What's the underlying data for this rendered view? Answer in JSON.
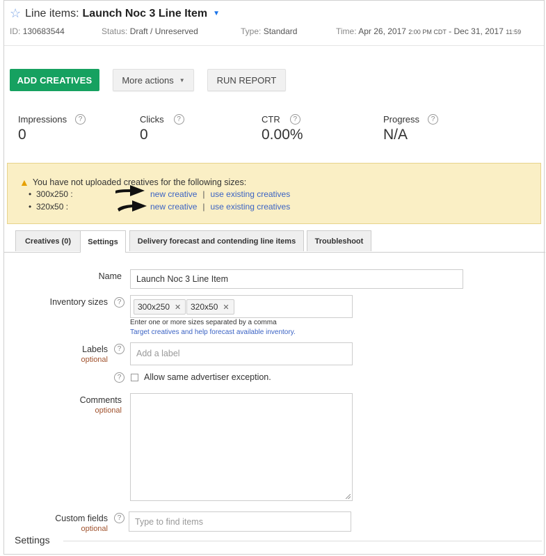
{
  "header": {
    "title_prefix": "Line items:",
    "title_name": "Launch Noc 3 Line Item",
    "id_label": "ID:",
    "id_value": "130683544",
    "status_label": "Status:",
    "status_value": "Draft / Unreserved",
    "type_label": "Type:",
    "type_value": "Standard",
    "time_label": "Time:",
    "time_start_date": "Apr 26, 2017",
    "time_start_clock": "2:00 PM CDT",
    "time_separator": "-",
    "time_end_date": "Dec 31, 2017",
    "time_end_clock": "11:59"
  },
  "toolbar": {
    "add_creatives": "ADD CREATIVES",
    "more_actions": "More actions",
    "run_report": "RUN REPORT"
  },
  "stats": [
    {
      "label": "Impressions",
      "value": "0"
    },
    {
      "label": "Clicks",
      "value": "0"
    },
    {
      "label": "CTR",
      "value": "0.00%"
    },
    {
      "label": "Progress",
      "value": "N/A"
    }
  ],
  "warning": {
    "message": "You have not uploaded creatives for the following sizes:",
    "rows": [
      {
        "size": "300x250 :",
        "new_link": "new creative",
        "sep": "|",
        "existing_link": "use existing creatives"
      },
      {
        "size": "320x50 :",
        "new_link": "new creative",
        "sep": "|",
        "existing_link": "use existing creatives"
      }
    ]
  },
  "tabs": [
    {
      "label": "Creatives (0)"
    },
    {
      "label": "Settings"
    },
    {
      "label": "Delivery forecast and contending line items"
    },
    {
      "label": "Troubleshoot"
    }
  ],
  "form": {
    "name_label": "Name",
    "name_value": "Launch Noc 3 Line Item",
    "inventory_label": "Inventory sizes",
    "sizes": [
      "300x250",
      "320x50"
    ],
    "inventory_hint": "Enter one or more sizes separated by a comma",
    "inventory_hint_link": "Target creatives and help forecast available inventory.",
    "labels_label": "Labels",
    "optional": "optional",
    "labels_placeholder": "Add a label",
    "allow_exception": "Allow same advertiser exception.",
    "comments_label": "Comments",
    "custom_fields_label": "Custom fields",
    "custom_fields_placeholder": "Type to find items",
    "section_settings": "Settings"
  },
  "colors": {
    "primary_button": "#16a160",
    "warning_bg": "#faefc5",
    "link": "#3b63c4",
    "optional": "#a0522d"
  },
  "icons": {
    "favorite": "star-outline-icon",
    "dropdown": "caret-down-icon",
    "help": "help-circle-icon",
    "warning": "warning-triangle-icon",
    "remove": "close-icon"
  }
}
